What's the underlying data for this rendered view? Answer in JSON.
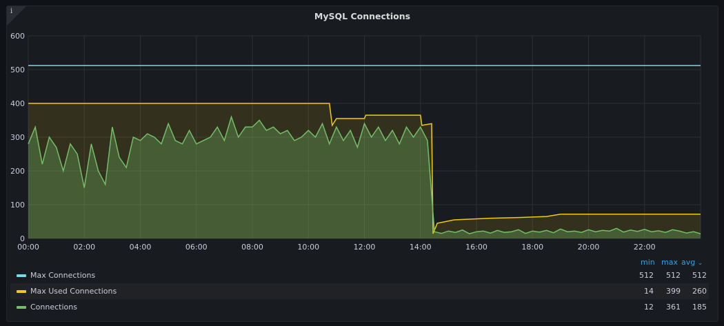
{
  "panel": {
    "title": "MySQL Connections",
    "info_icon": "i"
  },
  "legend": {
    "headers": {
      "min": "min",
      "max": "max",
      "avg": "avg"
    },
    "sort_icon": "chevron-down-icon",
    "items": [
      {
        "name": "Max Connections",
        "color": "#73dce6",
        "min": "512",
        "max": "512",
        "avg": "512"
      },
      {
        "name": "Max Used Connections",
        "color": "#f2cc0c",
        "min": "14",
        "max": "399",
        "avg": "260"
      },
      {
        "name": "Connections",
        "color": "#73bf69",
        "min": "12",
        "max": "361",
        "avg": "185"
      }
    ]
  },
  "chart_data": {
    "type": "line",
    "title": "MySQL Connections",
    "xlabel": "",
    "ylabel": "",
    "xlim_hours": [
      0,
      24
    ],
    "ylim": [
      0,
      600
    ],
    "y_ticks": [
      "0",
      "100",
      "200",
      "300",
      "400",
      "500",
      "600"
    ],
    "x_ticks": [
      "00:00",
      "02:00",
      "04:00",
      "06:00",
      "08:00",
      "10:00",
      "12:00",
      "14:00",
      "16:00",
      "18:00",
      "20:00",
      "22:00"
    ],
    "grid": true,
    "series": [
      {
        "name": "Max Connections",
        "x": [
          0,
          24
        ],
        "y": [
          512,
          512
        ]
      },
      {
        "name": "Max Used Connections",
        "x": [
          0,
          10.75,
          10.85,
          11.0,
          12.0,
          12.05,
          14.0,
          14.05,
          14.4,
          14.45,
          14.6,
          15.2,
          16.5,
          17.5,
          18.5,
          19.0,
          24
        ],
        "y": [
          400,
          400,
          335,
          355,
          355,
          365,
          365,
          335,
          340,
          14,
          45,
          55,
          60,
          62,
          65,
          72,
          72
        ]
      },
      {
        "name": "Connections",
        "x_start": 0,
        "x_step": 0.25,
        "y": [
          280,
          330,
          220,
          300,
          270,
          200,
          280,
          250,
          150,
          280,
          200,
          160,
          330,
          240,
          210,
          300,
          290,
          310,
          300,
          280,
          340,
          290,
          280,
          320,
          280,
          290,
          300,
          330,
          290,
          360,
          300,
          330,
          330,
          350,
          320,
          330,
          310,
          320,
          290,
          300,
          320,
          300,
          340,
          280,
          330,
          290,
          320,
          270,
          340,
          300,
          330,
          290,
          320,
          280,
          330,
          300,
          330,
          290,
          20,
          15,
          22,
          18,
          25,
          14,
          20,
          22,
          16,
          24,
          18,
          20,
          26,
          15,
          22,
          19,
          24,
          17,
          28,
          20,
          22,
          18,
          26,
          20,
          24,
          22,
          30,
          19,
          25,
          21,
          27,
          20,
          23,
          18,
          26,
          22,
          16,
          20,
          14
        ]
      }
    ]
  }
}
